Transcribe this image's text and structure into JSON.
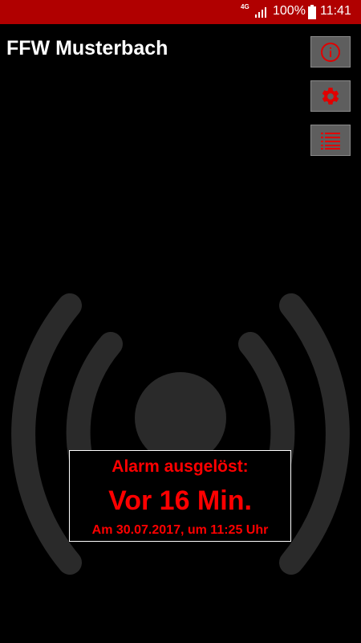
{
  "status_bar": {
    "network": "4G",
    "battery_pct": "100%",
    "time": "11:41"
  },
  "app": {
    "title": "FFW Musterbach"
  },
  "buttons": [
    {
      "name": "info",
      "icon": "info-icon"
    },
    {
      "name": "settings",
      "icon": "gear-icon"
    },
    {
      "name": "list",
      "icon": "list-icon"
    }
  ],
  "alarm": {
    "heading": "Alarm ausgelöst:",
    "relative": "Vor 16 Min.",
    "absolute": "Am 30.07.2017, um 11:25 Uhr"
  },
  "colors": {
    "status_bar": "#b00000",
    "accent": "#ff0000",
    "background": "#000000",
    "button": "#5e5e5e"
  }
}
